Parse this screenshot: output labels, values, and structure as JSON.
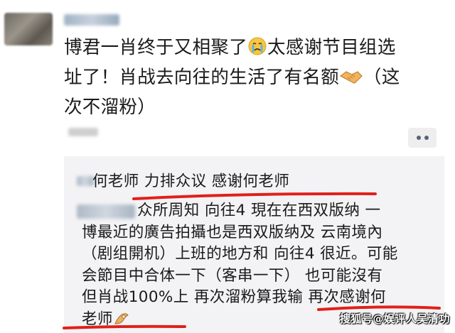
{
  "post": {
    "line1": "博君一肖终于又相聚了",
    "line1b": "太感谢节目组选",
    "line2": "址了！肖战去向往的生活了有名额",
    "line2b": "（这",
    "line3": "次不溜粉）"
  },
  "comments": [
    {
      "text": "何老师 力排众议 感谢何老师"
    },
    {
      "lines": [
        "众所周知 向往4 現在在西双版纳 一",
        "博最近的廣告拍攝也是西双版纳及 云南境內",
        "（剧组開机）上班的地方和 向往4 很近。可能",
        "会節目中合体一下（客串一下） 也可能沒有",
        "但肖战100%上 再次溜粉算我输 再次感谢何",
        "老师"
      ]
    }
  ],
  "icons": {
    "crying": "crying-face-icon",
    "handshake": "handshake-icon",
    "ok": "ok-hand-icon"
  },
  "watermark": "搜狐号@娱评人吴清功",
  "colors": {
    "underline": "#e0201a",
    "comment_bg": "#f3f3f5",
    "more_dots": "#55647a"
  }
}
